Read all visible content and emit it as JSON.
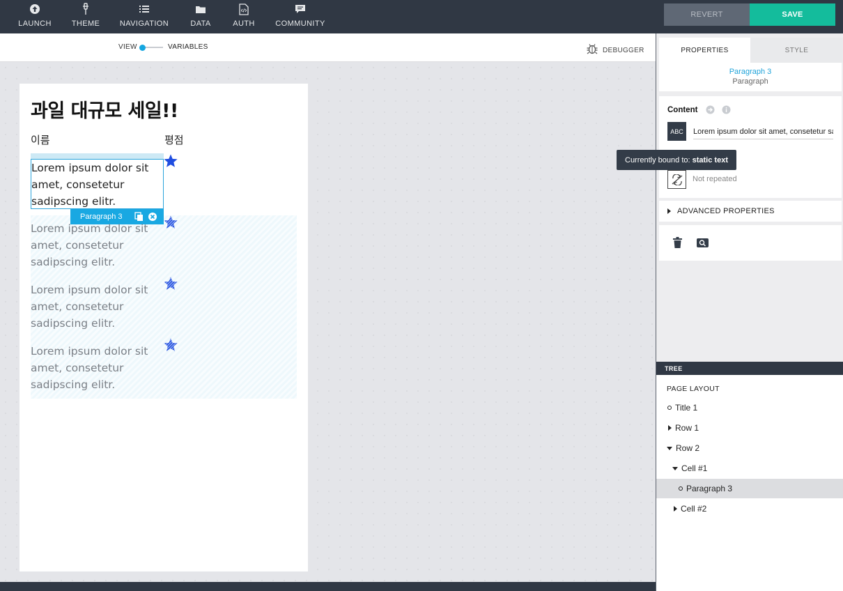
{
  "topbar": {
    "nav": [
      {
        "label": "LAUNCH",
        "icon": "launch-icon"
      },
      {
        "label": "THEME",
        "icon": "theme-icon"
      },
      {
        "label": "NAVIGATION",
        "icon": "navigation-icon"
      },
      {
        "label": "DATA",
        "icon": "data-folder-icon"
      },
      {
        "label": "AUTH",
        "icon": "auth-icon"
      },
      {
        "label": "COMMUNITY",
        "icon": "community-icon"
      }
    ],
    "revert_label": "REVERT",
    "save_label": "SAVE"
  },
  "toolbar": {
    "view_label": "VIEW",
    "variables_label": "VARIABLES",
    "debugger_label": "DEBUGGER"
  },
  "canvas": {
    "heading": "과일 대규모 세일!!",
    "col_name": "이름",
    "col_rating": "평점",
    "rows": [
      {
        "text": "Lorem ipsum dolor sit amet, consetetur sadipscing elitr."
      },
      {
        "text": "Lorem ipsum dolor sit amet, consetetur sadipscing elitr."
      },
      {
        "text": "Lorem ipsum dolor sit amet, consetetur sadipscing elitr."
      },
      {
        "text": "Lorem ipsum dolor sit amet, consetetur sadipscing elitr."
      }
    ],
    "selection_tag": "Paragraph 3"
  },
  "properties": {
    "tab_properties": "PROPERTIES",
    "tab_style": "STYLE",
    "component_name": "Paragraph 3",
    "component_type": "Paragraph",
    "content_title": "Content",
    "text_type_icon": "ABC",
    "content_value": "Lorem ipsum dolor sit amet, consetetur sadipscing elitr.",
    "tooltip_prefix": "Currently bound to: ",
    "tooltip_value": "static text",
    "repeat_text": "Not repeated",
    "advanced_label": "ADVANCED PROPERTIES"
  },
  "tree": {
    "header": "TREE",
    "root": "PAGE LAYOUT",
    "nodes": [
      {
        "label": "Title 1"
      },
      {
        "label": "Row 1"
      },
      {
        "label": "Row 2"
      },
      {
        "label": "Cell #1"
      },
      {
        "label": "Paragraph 3"
      },
      {
        "label": "Cell #2"
      }
    ]
  },
  "colors": {
    "topbar": "#303844",
    "save": "#14bc9c",
    "accent": "#19a8e2",
    "star": "#1f4de0"
  }
}
